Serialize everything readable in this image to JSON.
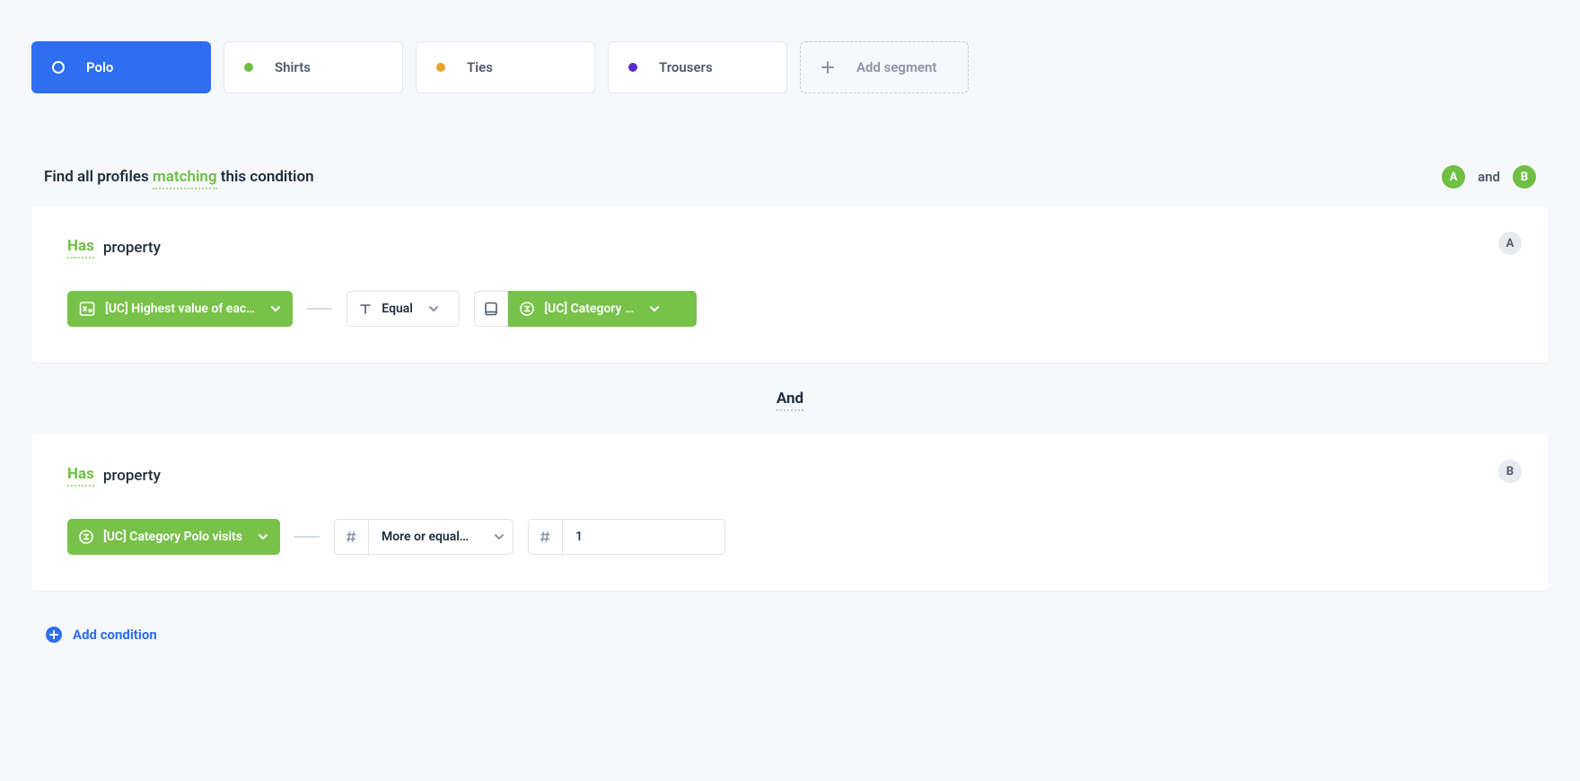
{
  "segments": {
    "items": [
      {
        "label": "Polo",
        "color": "#ffffff",
        "active": true
      },
      {
        "label": "Shirts",
        "color": "#6fbf44",
        "active": false
      },
      {
        "label": "Ties",
        "color": "#f0a22e",
        "active": false
      },
      {
        "label": "Trousers",
        "color": "#5a2ec9",
        "active": false
      }
    ],
    "add_label": "Add segment"
  },
  "header": {
    "prefix": "Find all profiles",
    "matching": "matching",
    "suffix": "this condition",
    "and_word": "and",
    "badge_a": "A",
    "badge_b": "B"
  },
  "card_a": {
    "has": "Has",
    "prop": "property",
    "badge": "A",
    "attr_label": "[UC] Highest value of eac…",
    "op_label": "Equal",
    "value_label": "[UC] Category …"
  },
  "separator": {
    "and": "And"
  },
  "card_b": {
    "has": "Has",
    "prop": "property",
    "badge": "B",
    "attr_label": "[UC] Category Polo visits",
    "op_label": "More or equal…",
    "value": "1"
  },
  "add_condition": {
    "label": "Add condition"
  }
}
